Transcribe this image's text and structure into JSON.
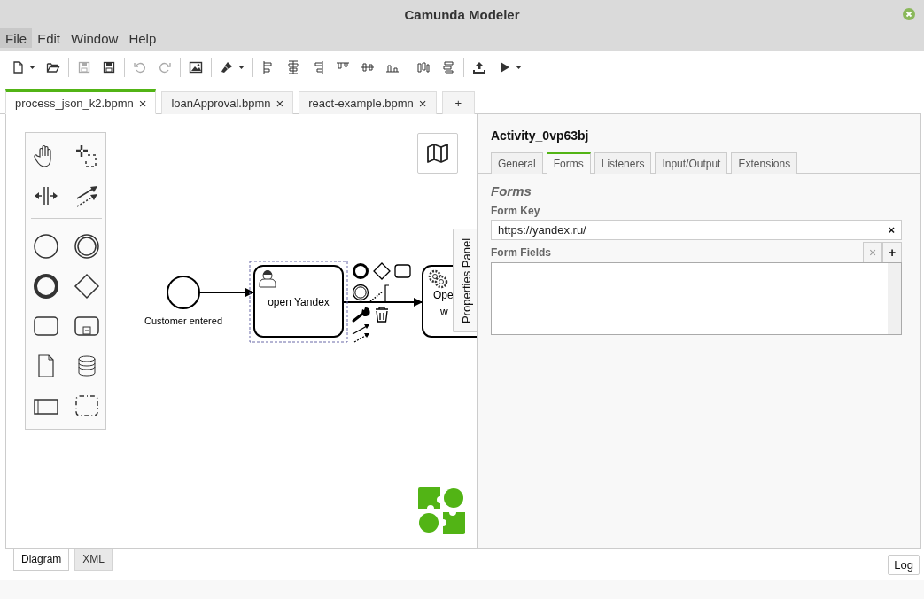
{
  "window": {
    "title": "Camunda Modeler"
  },
  "menu": [
    {
      "label": "File",
      "selected": true
    },
    {
      "label": "Edit",
      "selected": false
    },
    {
      "label": "Window",
      "selected": false
    },
    {
      "label": "Help",
      "selected": false
    }
  ],
  "toolbar": [
    {
      "kind": "new",
      "disabled": false,
      "caret": true
    },
    {
      "kind": "open",
      "disabled": false
    },
    {
      "kind": "sep"
    },
    {
      "kind": "save",
      "disabled": true
    },
    {
      "kind": "saveas",
      "disabled": false
    },
    {
      "kind": "sep"
    },
    {
      "kind": "undo",
      "disabled": true
    },
    {
      "kind": "redo",
      "disabled": true
    },
    {
      "kind": "sep"
    },
    {
      "kind": "image",
      "disabled": false
    },
    {
      "kind": "sep"
    },
    {
      "kind": "brush",
      "disabled": false,
      "caret": true
    },
    {
      "kind": "sep"
    },
    {
      "kind": "alignleft",
      "disabled": false
    },
    {
      "kind": "aligncenter",
      "disabled": false
    },
    {
      "kind": "alignright",
      "disabled": false
    },
    {
      "kind": "aligntop",
      "disabled": false
    },
    {
      "kind": "alignmiddle",
      "disabled": false
    },
    {
      "kind": "alignbottom",
      "disabled": false
    },
    {
      "kind": "sep"
    },
    {
      "kind": "disth",
      "disabled": false
    },
    {
      "kind": "distv",
      "disabled": false
    },
    {
      "kind": "sep"
    },
    {
      "kind": "deploy",
      "disabled": false
    },
    {
      "kind": "run",
      "disabled": false,
      "caret": true
    }
  ],
  "file_tabs": [
    {
      "label": "process_json_k2.bpmn",
      "close": "×",
      "selected": true
    },
    {
      "label": "loanApproval.bpmn",
      "close": "×",
      "selected": false
    },
    {
      "label": "react-example.bpmn",
      "close": "×",
      "selected": false
    }
  ],
  "new_tab": "+",
  "diagram": {
    "start_event": {
      "label": "Customer entered"
    },
    "tasks": [
      {
        "kind": "user",
        "lines": [
          "open Yandex"
        ],
        "selected": true
      },
      {
        "kind": "service",
        "lines": [
          "Ope",
          "w"
        ],
        "selected": false
      }
    ]
  },
  "properties_toggle": "Properties Panel",
  "properties": {
    "title": "Activity_0vp63bj",
    "tabs": [
      {
        "label": "General",
        "selected": false
      },
      {
        "label": "Forms",
        "selected": true
      },
      {
        "label": "Listeners",
        "selected": false
      },
      {
        "label": "Input/Output",
        "selected": false
      },
      {
        "label": "Extensions",
        "selected": false
      }
    ],
    "group_title": "Forms",
    "form_key": {
      "label": "Form Key",
      "value": "https://yandex.ru/",
      "clear": "×"
    },
    "form_fields": {
      "label": "Form Fields",
      "remove": "×",
      "add": "+"
    }
  },
  "view_tabs": [
    {
      "label": "Diagram",
      "selected": true
    },
    {
      "label": "XML",
      "selected": false
    }
  ],
  "log_button": "Log"
}
